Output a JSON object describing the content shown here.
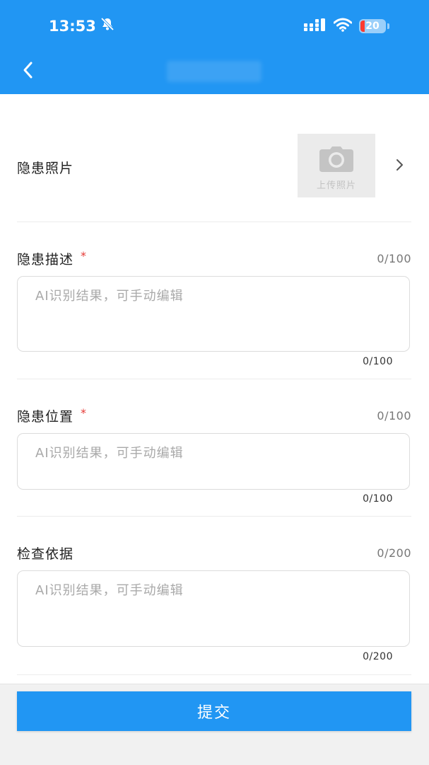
{
  "status_bar": {
    "time": "13:53",
    "battery": "20",
    "icons": [
      "bell-muted-icon",
      "signal-icon",
      "wifi-icon",
      "battery-icon"
    ]
  },
  "header": {
    "back_icon": "chevron-left-icon",
    "background": "#2196f3"
  },
  "form": {
    "photo": {
      "label": "隐患照片",
      "upload_text": "上传照片",
      "icon": "camera-icon"
    },
    "description": {
      "label": "隐患描述",
      "required_mark": "*",
      "counter": "0/100",
      "placeholder": "AI识别结果，可手动编辑",
      "sub_counter": "0/100"
    },
    "location": {
      "label": "隐患位置",
      "required_mark": "*",
      "counter": "0/100",
      "placeholder": "AI识别结果，可手动编辑",
      "sub_counter": "0/100"
    },
    "basis": {
      "label": "检查依据",
      "counter": "0/200",
      "placeholder": "AI识别结果，可手动编辑",
      "sub_counter": "0/200"
    }
  },
  "footer": {
    "submit_label": "提交"
  },
  "colors": {
    "accent": "#2196f3",
    "required": "#e53935",
    "placeholder": "#a9a9a9"
  }
}
